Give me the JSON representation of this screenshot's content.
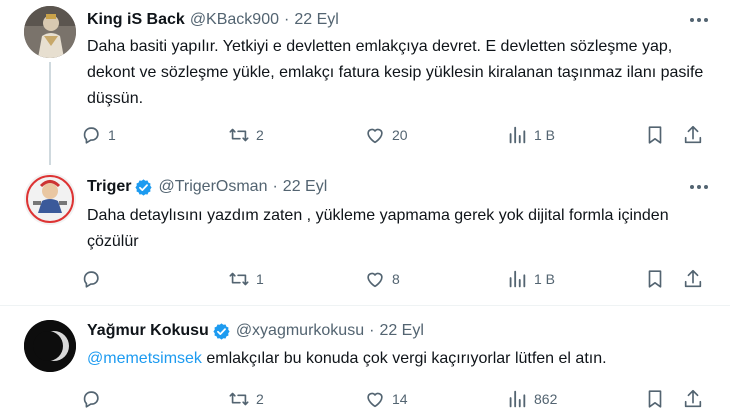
{
  "tweets": [
    {
      "name": "King iS Back",
      "handle": "@KBack900",
      "separator": "·",
      "date": "22 Eyl",
      "verified": false,
      "text": "Daha basiti yapılır. Yetkiyi e devletten emlakçıya devret. E devletten sözleşme yap, dekont ve sözleşme yükle, emlakçı fatura kesip yüklesin kiralanan taşınmaz ilanı pasife düşsün.",
      "replies": "1",
      "retweets": "2",
      "likes": "20",
      "views": "1 B"
    },
    {
      "name": "Triger",
      "handle": "@TrigerOsman",
      "separator": "·",
      "date": "22 Eyl",
      "verified": true,
      "text": "Daha detaylısını yazdım zaten , yükleme yapmama gerek yok dijital formla içinden çözülür",
      "replies": "",
      "retweets": "1",
      "likes": "8",
      "views": "1 B"
    },
    {
      "name": "Yağmur Kokusu",
      "handle": "@xyagmurkokusu",
      "separator": "·",
      "date": "22 Eyl",
      "verified": true,
      "mention": "@memetsimsek",
      "text": " emlakçılar bu konuda çok vergi kaçırıyorlar lütfen el atın.",
      "replies": "",
      "retweets": "2",
      "likes": "14",
      "views": "862"
    }
  ],
  "colors": {
    "accent": "#1d9bf0",
    "muted": "#536471",
    "text": "#0f1419",
    "divider": "#eff3f4"
  },
  "icons": [
    "more-icon",
    "reply-icon",
    "retweet-icon",
    "like-icon",
    "views-icon",
    "bookmark-icon",
    "share-icon",
    "verified-icon"
  ]
}
